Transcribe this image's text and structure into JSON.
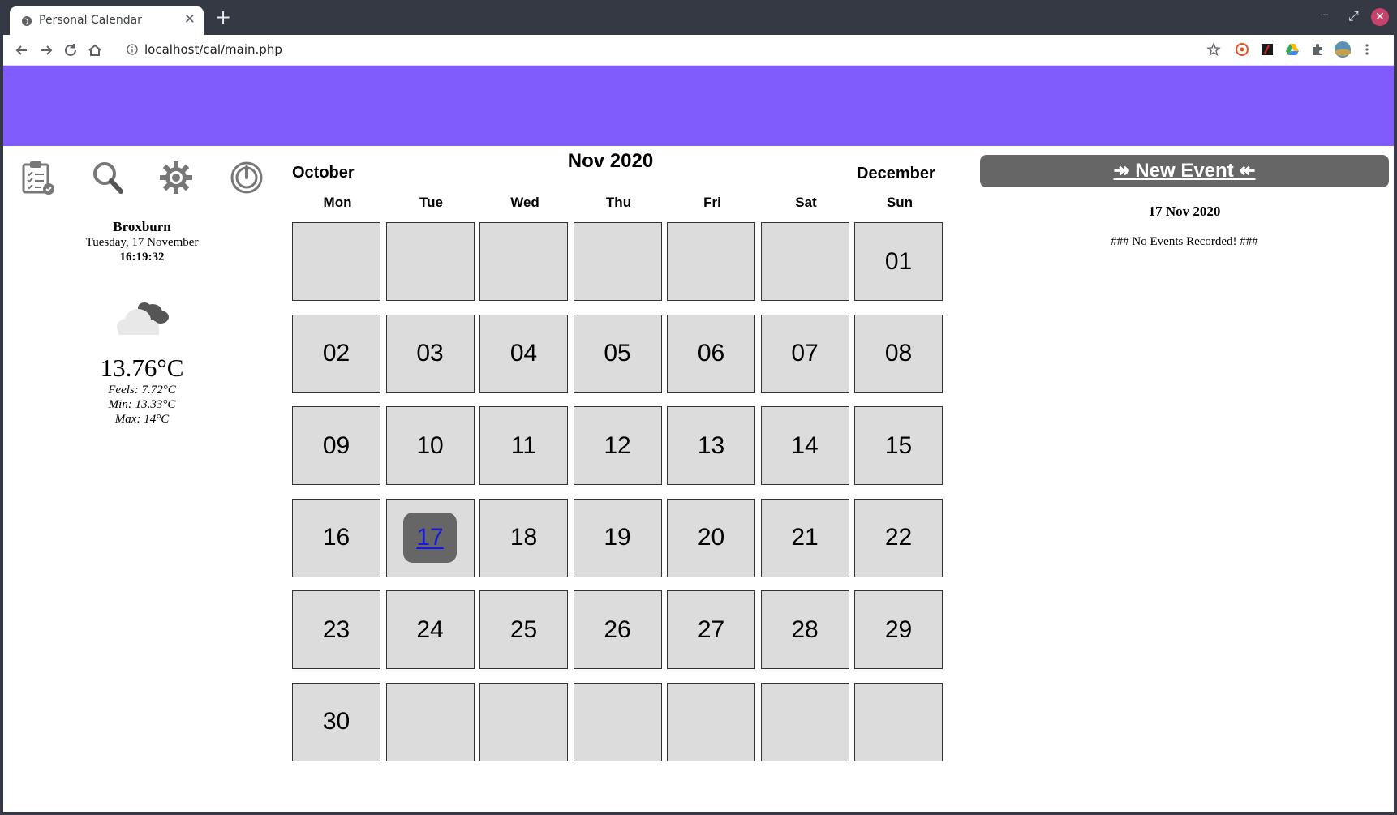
{
  "browser": {
    "tab_title": "Personal Calendar",
    "tab_close": "✕",
    "new_tab": "+",
    "url": "localhost/cal/main.php",
    "window_controls": {
      "minimize": "–",
      "maximize": "⤢",
      "close": "✕"
    }
  },
  "sidebar": {
    "icons": [
      "todo-list-icon",
      "search-icon",
      "settings-gear-icon",
      "power-icon"
    ],
    "location": "Broxburn",
    "date": "Tuesday, 17 November",
    "time": "16:19:32",
    "weather_icon": "cloudy-icon",
    "temperature": "13.76°C",
    "feels": "Feels: 7.72°C",
    "min": "Min: 13.33°C",
    "max": "Max: 14°C"
  },
  "calendar": {
    "prev_month": "October",
    "title": "Nov 2020",
    "next_month": "December",
    "weekdays": [
      "Mon",
      "Tue",
      "Wed",
      "Thu",
      "Fri",
      "Sat",
      "Sun"
    ],
    "weeks": [
      [
        "",
        "",
        "",
        "",
        "",
        "",
        "01"
      ],
      [
        "02",
        "03",
        "04",
        "05",
        "06",
        "07",
        "08"
      ],
      [
        "09",
        "10",
        "11",
        "12",
        "13",
        "14",
        "15"
      ],
      [
        "16",
        "17",
        "18",
        "19",
        "20",
        "21",
        "22"
      ],
      [
        "23",
        "24",
        "25",
        "26",
        "27",
        "28",
        "29"
      ],
      [
        "30",
        "",
        "",
        "",
        "",
        "",
        ""
      ]
    ],
    "today": "17"
  },
  "events": {
    "new_event_label": "↠ New Event ↞",
    "selected_date": "17 Nov 2020",
    "empty_message": "### No Events Recorded! ###"
  },
  "colors": {
    "banner": "#7f5cfb",
    "cell_bg": "#dcdcdc",
    "today_bg": "#666666",
    "button_bg": "#666666",
    "chrome": "#353944"
  }
}
